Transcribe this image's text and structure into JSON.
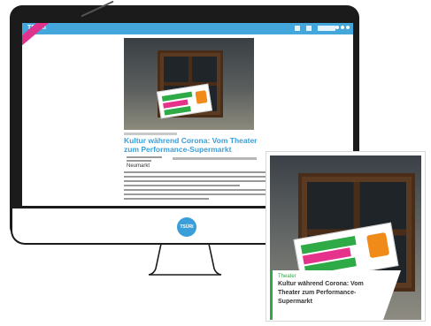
{
  "site": {
    "logo": "TSÜRI"
  },
  "article": {
    "title": "Kultur während Corona: Vom Theater zum Performance-Supermarkt",
    "logo_text": "Neumarkt"
  },
  "monitor": {
    "logo": "TSÜRI"
  },
  "card": {
    "kicker": "Theater",
    "title": "Kultur während Corona: Vom Theater zum Performance-Supermarkt"
  },
  "colors": {
    "accent_blue": "#43a7db",
    "accent_green": "#2eaa47",
    "accent_pink": "#e0338e",
    "frame": "#1b1b1b"
  }
}
